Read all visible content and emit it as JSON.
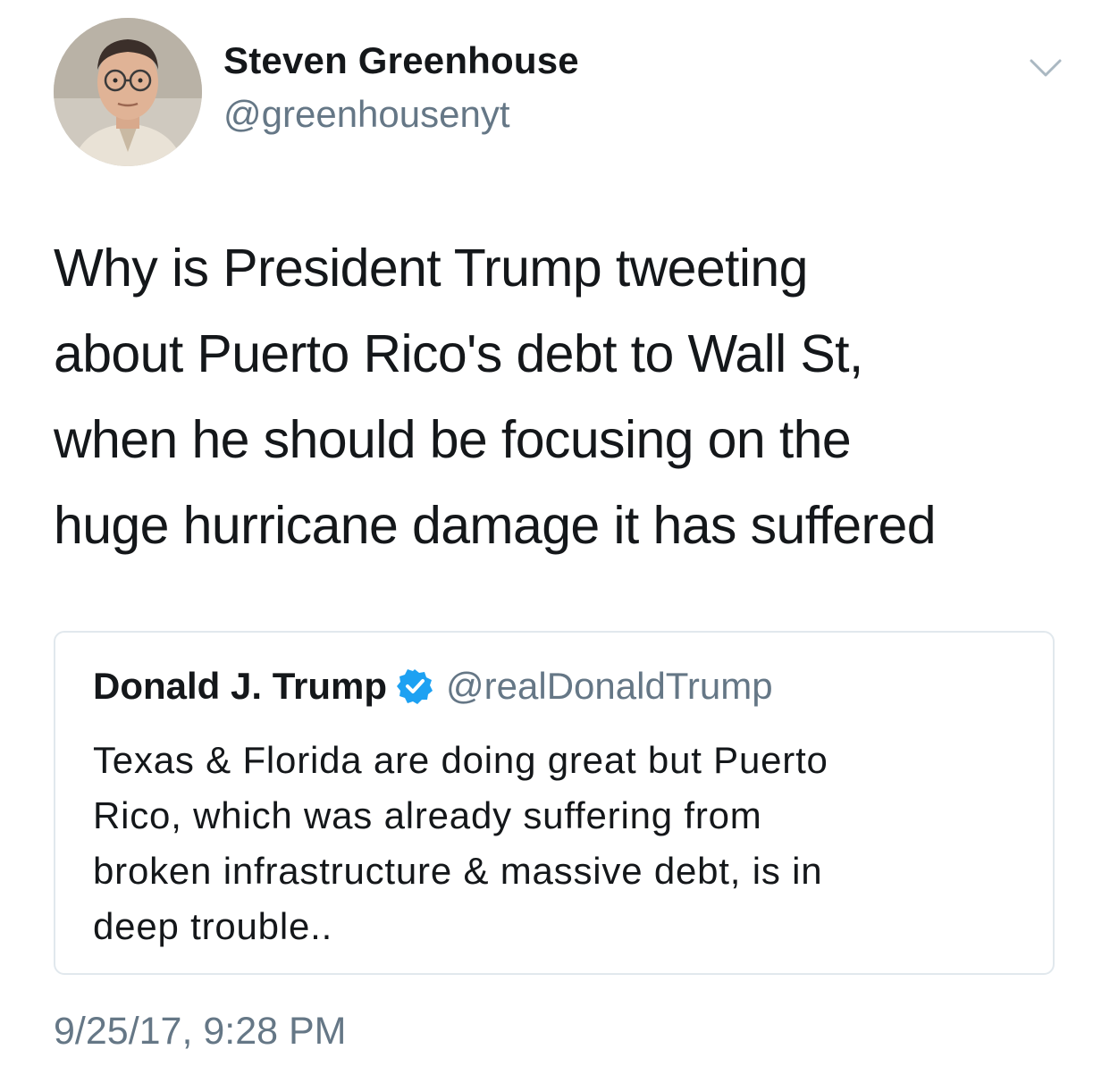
{
  "author": {
    "display_name": "Steven Greenhouse",
    "handle": "@greenhousenyt"
  },
  "tweet": {
    "text": "Why is President Trump tweeting\nabout Puerto Rico's debt to Wall St,\nwhen he should be focusing on the\nhuge hurricane damage it has suffered",
    "timestamp": "9/25/17, 9:28 PM"
  },
  "quoted_tweet": {
    "display_name": "Donald J. Trump",
    "verified": true,
    "handle": "@realDonaldTrump",
    "text": "Texas & Florida are doing great but Puerto\nRico, which was already suffering from\nbroken infrastructure & massive debt, is in\ndeep trouble.."
  },
  "icons": {
    "menu": "chevron-down-icon",
    "verified": "verified-badge-icon"
  },
  "colors": {
    "text": "#14171a",
    "secondary_text": "#657786",
    "border": "#e1e8ed",
    "verified_blue": "#1da1f2"
  }
}
